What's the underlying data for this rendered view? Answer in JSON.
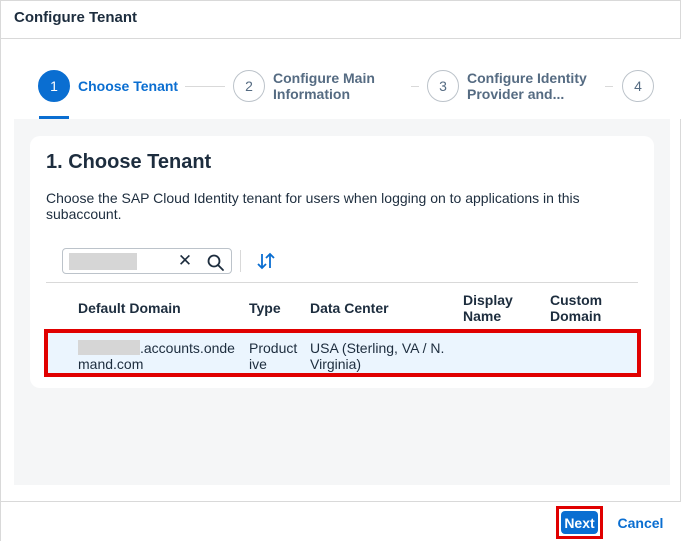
{
  "dialog": {
    "title": "Configure Tenant"
  },
  "wizard": {
    "steps": [
      {
        "number": "1",
        "label": "Choose Tenant",
        "active": true
      },
      {
        "number": "2",
        "label_line1": "Configure Main",
        "label_line2": "Information"
      },
      {
        "number": "3",
        "label_line1": "Configure Identity",
        "label_line2": "Provider and..."
      },
      {
        "number": "4"
      }
    ]
  },
  "card": {
    "title": "1. Choose Tenant",
    "description": "Choose the SAP Cloud Identity tenant for users when logging on to applications in this subaccount."
  },
  "search": {
    "value": "",
    "clear_icon": "close-icon",
    "search_icon": "search-icon"
  },
  "table": {
    "headers": {
      "domain": "Default Domain",
      "type": "Type",
      "data_center": "Data Center",
      "display_name": "Display Name",
      "custom_domain": "Custom Domain"
    },
    "rows": [
      {
        "domain_suffix_line1": ".accounts.onde",
        "domain_suffix_line2": "mand.com",
        "type": "Productive",
        "data_center": "USA (Sterling, VA / N. Virginia)",
        "display_name": "",
        "custom_domain": ""
      }
    ]
  },
  "footer": {
    "next_label": "Next",
    "cancel_label": "Cancel"
  },
  "colors": {
    "accent": "#0a6ed1",
    "highlight": "#e00000",
    "text": "#1d2d3e"
  }
}
